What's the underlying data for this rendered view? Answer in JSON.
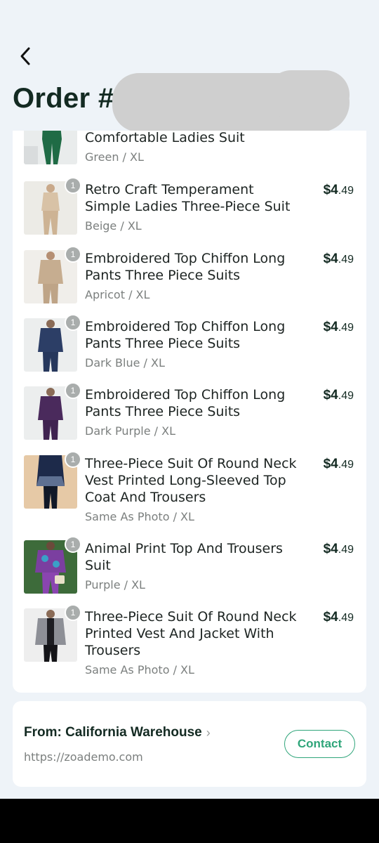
{
  "header": {
    "title_prefix": "Order #"
  },
  "items": [
    {
      "name": "Comfortable Ladies Suit",
      "variant": "Green / XL",
      "qty": "",
      "price_main": "",
      "price_cents": "",
      "img": "green"
    },
    {
      "name": "Retro Craft Temperament Simple Ladies Three-Piece Suit",
      "variant": "Beige / XL",
      "qty": "1",
      "price_main": "$4",
      "price_cents": ".49",
      "img": "beige"
    },
    {
      "name": "Embroidered Top Chiffon Long Pants Three Piece Suits",
      "variant": "Apricot / XL",
      "qty": "1",
      "price_main": "$4",
      "price_cents": ".49",
      "img": "apricot"
    },
    {
      "name": "Embroidered Top Chiffon Long Pants Three Piece Suits",
      "variant": "Dark Blue / XL",
      "qty": "1",
      "price_main": "$4",
      "price_cents": ".49",
      "img": "darkblue"
    },
    {
      "name": "Embroidered Top Chiffon Long Pants Three Piece Suits",
      "variant": "Dark Purple / XL",
      "qty": "1",
      "price_main": "$4",
      "price_cents": ".49",
      "img": "darkpurple"
    },
    {
      "name": "Three-Piece Suit Of Round Neck Vest Printed Long-Sleeved Top Coat And Trousers",
      "variant": "Same As Photo / XL",
      "qty": "1",
      "price_main": "$4",
      "price_cents": ".49",
      "img": "navyprint"
    },
    {
      "name": "Animal Print Top And Trousers Suit",
      "variant": "Purple / XL",
      "qty": "1",
      "price_main": "$4",
      "price_cents": ".49",
      "img": "purpleprint"
    },
    {
      "name": "Three-Piece Suit Of Round Neck Printed Vest And Jacket With Trousers",
      "variant": "Same As Photo / XL",
      "qty": "1",
      "price_main": "$4",
      "price_cents": ".49",
      "img": "greyjacket"
    }
  ],
  "warehouse": {
    "from_label": "From: California Warehouse",
    "url": "https://zoademo.com",
    "contact_label": "Contact"
  },
  "colors": {
    "accent": "#2fa57a",
    "title": "#132a22",
    "background": "#eef3f8"
  },
  "icons": {
    "back": "chevron-left-icon",
    "from_chevron": "chevron-right-icon"
  }
}
